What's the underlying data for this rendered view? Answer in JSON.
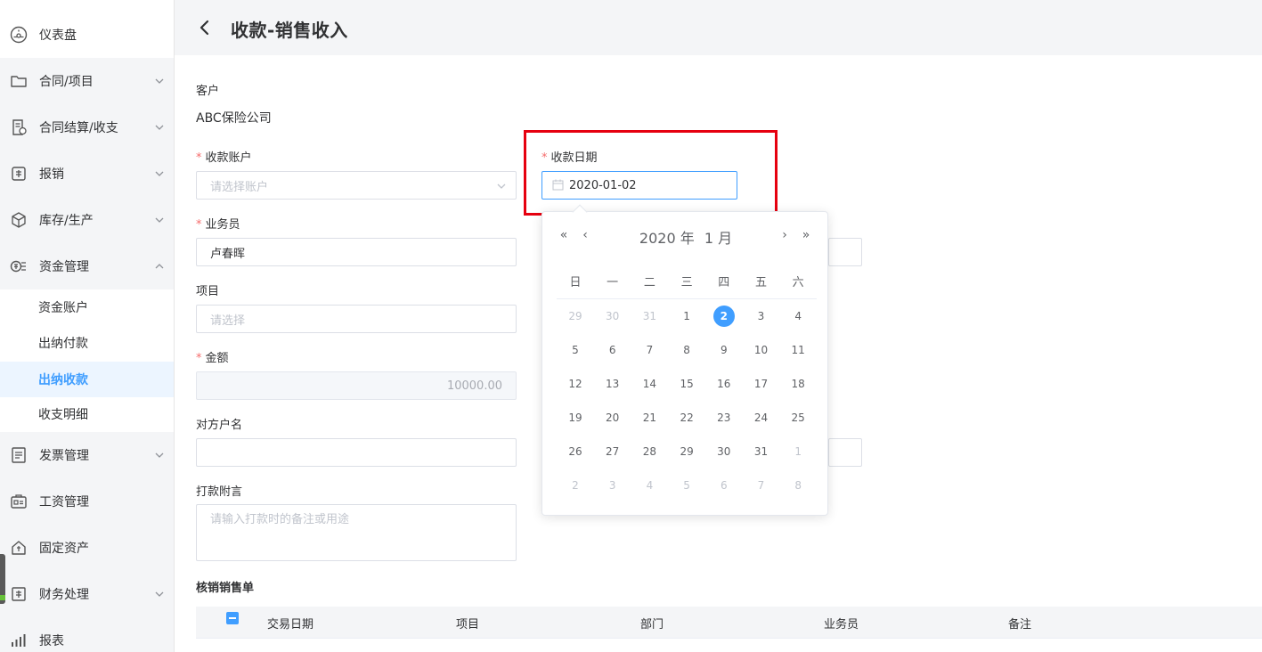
{
  "sidebar": {
    "items": [
      {
        "label": "仪表盘"
      },
      {
        "label": "合同/项目"
      },
      {
        "label": "合同结算/收支"
      },
      {
        "label": "报销"
      },
      {
        "label": "库存/生产"
      },
      {
        "label": "资金管理"
      },
      {
        "label": "发票管理"
      },
      {
        "label": "工资管理"
      },
      {
        "label": "固定资产"
      },
      {
        "label": "财务处理"
      },
      {
        "label": "报表"
      }
    ],
    "subitems": [
      {
        "label": "资金账户"
      },
      {
        "label": "出纳付款"
      },
      {
        "label": "出纳收款"
      },
      {
        "label": "收支明细"
      }
    ]
  },
  "header": {
    "back_glyph": "‹",
    "title": "收款-销售收入"
  },
  "form": {
    "required_mark": "*",
    "customer_label": "客户",
    "customer_value": "ABC保险公司",
    "account_label": "收款账户",
    "account_placeholder": "请选择账户",
    "date_label": "收款日期",
    "date_value": "2020-01-02",
    "salesperson_label": "业务员",
    "salesperson_value": "卢春晖",
    "project_label": "项目",
    "project_placeholder": "请选择",
    "amount_label": "金额",
    "amount_value": "10000.00",
    "payer_label": "对方户名",
    "payer_value": "",
    "note_label": "打款附言",
    "note_placeholder": "请输入打款时的备注或用途"
  },
  "datepicker": {
    "prev_year": "«",
    "prev_month": "‹",
    "next_month": "›",
    "next_year": "»",
    "year_label": "2020 年",
    "month_label": "1 月",
    "weekdays": [
      "日",
      "一",
      "二",
      "三",
      "四",
      "五",
      "六"
    ],
    "days": [
      [
        "29",
        "30",
        "31",
        "1",
        "2",
        "3",
        "4"
      ],
      [
        "5",
        "6",
        "7",
        "8",
        "9",
        "10",
        "11"
      ],
      [
        "12",
        "13",
        "14",
        "15",
        "16",
        "17",
        "18"
      ],
      [
        "19",
        "20",
        "21",
        "22",
        "23",
        "24",
        "25"
      ],
      [
        "26",
        "27",
        "28",
        "29",
        "30",
        "31",
        "1"
      ],
      [
        "2",
        "3",
        "4",
        "5",
        "6",
        "7",
        "8"
      ]
    ]
  },
  "table": {
    "title": "核销销售单",
    "columns": [
      "交易日期",
      "项目",
      "部门",
      "业务员",
      "备注"
    ]
  },
  "colors": {
    "accent": "#409eff",
    "highlight": "#e6000f",
    "required": "#f56c6c"
  }
}
